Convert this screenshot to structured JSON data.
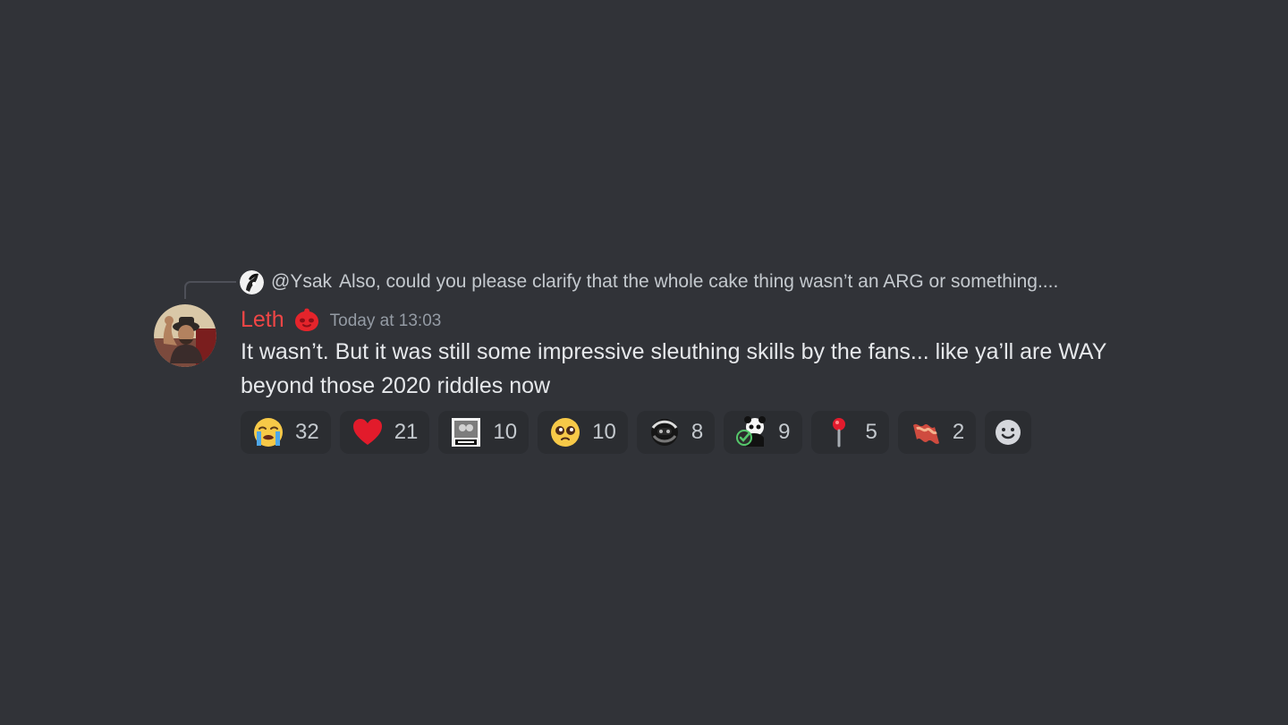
{
  "reply": {
    "author": "@Ysak",
    "text": "Also, could you please clarify that the whole cake thing wasn’t an ARG or something...."
  },
  "message": {
    "author": "Leth",
    "timestamp": "Today at 13:03",
    "content": "It wasn’t. But it was still some impressive sleuthing skills by the fans... like ya’ll are WAY beyond those 2020 riddles now"
  },
  "reactions": [
    {
      "icon": "loudly-crying-face-icon",
      "count": "32"
    },
    {
      "icon": "red-heart-icon",
      "count": "21"
    },
    {
      "icon": "true-meme-sticker-icon",
      "count": "10"
    },
    {
      "icon": "pleading-face-icon",
      "count": "10"
    },
    {
      "icon": "masked-character-icon",
      "count": "8"
    },
    {
      "icon": "panda-check-icon",
      "count": "9"
    },
    {
      "icon": "round-pushpin-icon",
      "count": "5"
    },
    {
      "icon": "bacon-icon",
      "count": "2"
    }
  ],
  "add_reaction": {
    "icon": "add-reaction-smiley-icon"
  },
  "colors": {
    "background": "#313338",
    "author_name": "#f04646",
    "timestamp": "#949ba4",
    "reaction_bg": "#2b2d31",
    "reply_line": "#4e5058"
  }
}
